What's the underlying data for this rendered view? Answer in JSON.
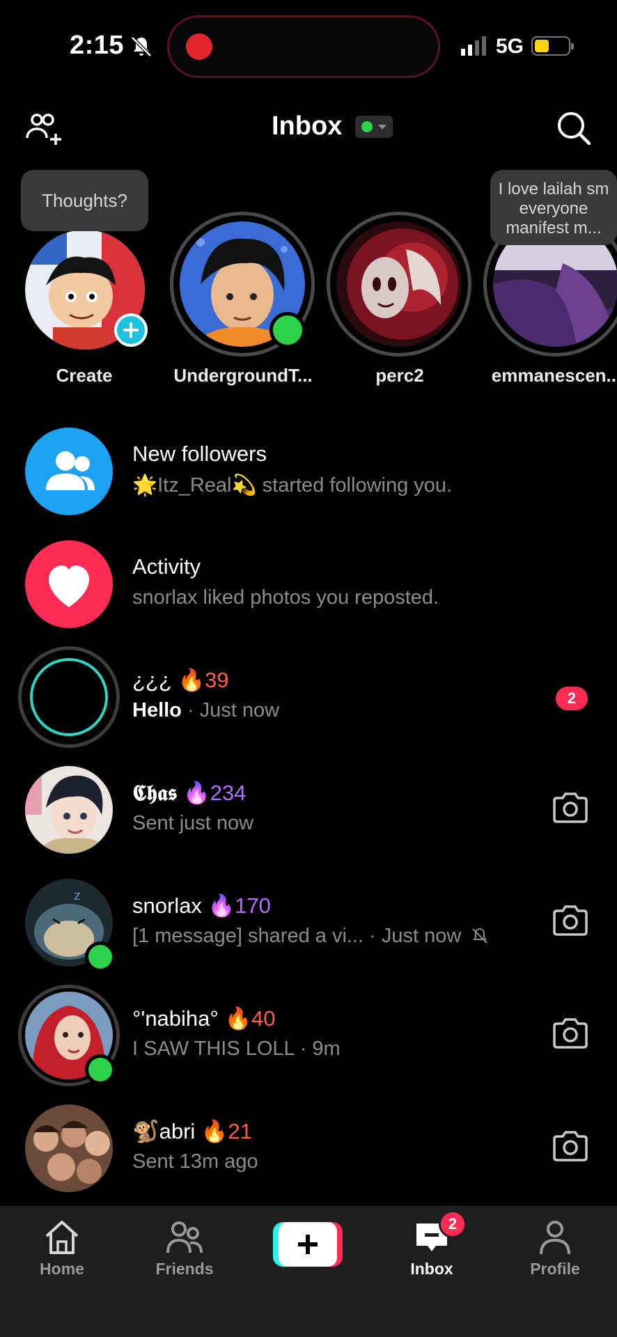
{
  "status_bar": {
    "time": "2:15",
    "network": "5G",
    "icons": [
      "bell-slash-icon",
      "recording-dot-icon",
      "signal-icon",
      "battery-icon"
    ],
    "colors": {
      "recording": "#e0262b",
      "battery": "#ffd30a"
    }
  },
  "header": {
    "title": "Inbox",
    "status_indicator": "online",
    "icons": [
      "add-friend-icon",
      "search-icon"
    ]
  },
  "stories": [
    {
      "name": "Create",
      "bubble": "Thoughts?",
      "badge": "plus"
    },
    {
      "name": "UndergroundT...",
      "online": true
    },
    {
      "name": "perc2"
    },
    {
      "name": "emmanescen...",
      "bubble": "I love lailah sm everyone manifest m..."
    }
  ],
  "system_rows": [
    {
      "title": "New followers",
      "subtitle": "🌟Itz_Real💫 started following you.",
      "icon": "followers-icon",
      "color": "#1da1f2"
    },
    {
      "title": "Activity",
      "subtitle": "snorlax liked photos you reposted.",
      "icon": "heart-icon",
      "color": "#fe2c55"
    }
  ],
  "chats": [
    {
      "name": "¿¿¿",
      "streak": "39",
      "streak_color": "#ff5a4e",
      "message": "Hello",
      "time": " · Just now",
      "unread": "2"
    },
    {
      "name": "𝕮𝖍𝖆𝖘",
      "streak": "234",
      "streak_color": "#b36cff",
      "message": "Sent just now",
      "action_icon": "camera-icon"
    },
    {
      "name": "snorlax",
      "streak": "170",
      "streak_color": "#b36cff",
      "message": "[1 message] shared a vi...",
      "time": " · Just now",
      "muted": true,
      "online": true,
      "action_icon": "camera-icon"
    },
    {
      "name": "°'nabiha°",
      "streak": "40",
      "streak_color": "#ff5a4e",
      "message": "I SAW THIS LOLL",
      "time": " · 9m",
      "online": true,
      "action_icon": "camera-icon"
    },
    {
      "name": "🐒abri",
      "streak": "21",
      "streak_color": "#ff5a4e",
      "message": "Sent 13m ago",
      "action_icon": "camera-icon"
    }
  ],
  "bottom_nav": {
    "home": "Home",
    "friends": "Friends",
    "inbox": "Inbox",
    "profile": "Profile",
    "inbox_badge": "2",
    "active": "inbox"
  }
}
